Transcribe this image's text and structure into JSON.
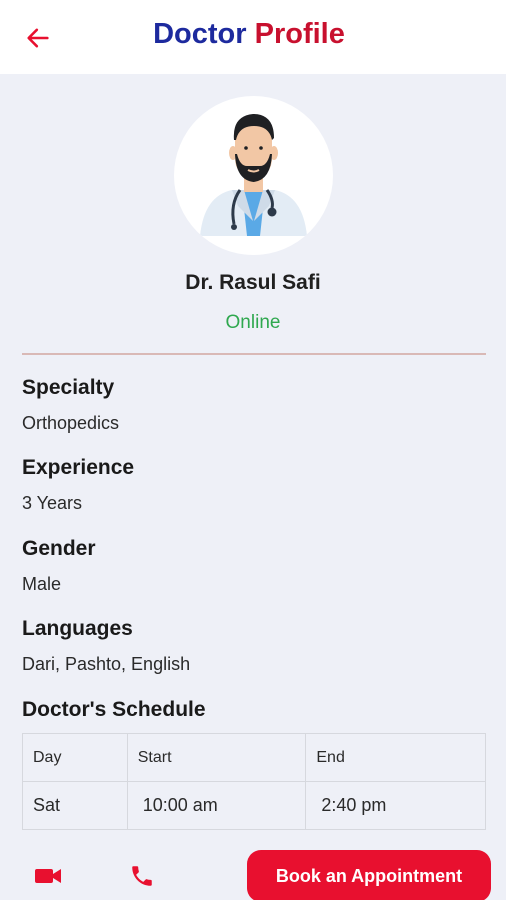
{
  "header": {
    "title_part1": "Doctor",
    "title_part2": "Profile",
    "back_icon": "arrow-left-icon",
    "accent_color": "#e8102f"
  },
  "doctor": {
    "avatar_icon": "doctor-avatar-icon",
    "name": "Dr. Rasul Safi",
    "status": "Online",
    "status_color": "#2fa84f"
  },
  "details": [
    {
      "label": "Specialty",
      "value": "Orthopedics"
    },
    {
      "label": "Experience",
      "value": "3 Years"
    },
    {
      "label": "Gender",
      "value": "Male"
    },
    {
      "label": "Languages",
      "value": "Dari, Pashto, English"
    }
  ],
  "schedule": {
    "title": "Doctor's Schedule",
    "headers": [
      "Day",
      "Start",
      "End"
    ],
    "rows": [
      [
        "Sat",
        " 10:00 am",
        " 2:40 pm"
      ]
    ]
  },
  "actions": {
    "video_icon": "video-camera-icon",
    "call_icon": "phone-icon",
    "book_label": "Book an Appointment"
  }
}
